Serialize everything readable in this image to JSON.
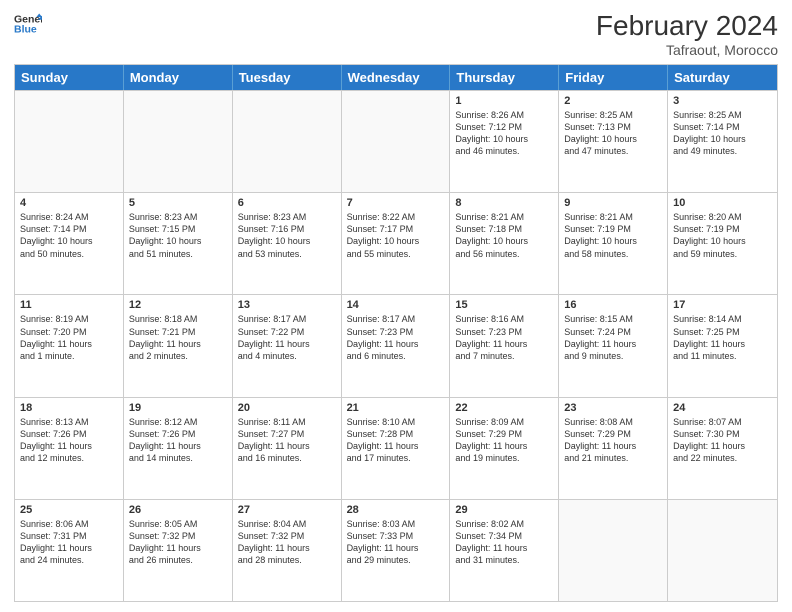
{
  "header": {
    "logo_line1": "General",
    "logo_line2": "Blue",
    "month_year": "February 2024",
    "location": "Tafraout, Morocco"
  },
  "weekdays": [
    "Sunday",
    "Monday",
    "Tuesday",
    "Wednesday",
    "Thursday",
    "Friday",
    "Saturday"
  ],
  "rows": [
    [
      {
        "day": "",
        "info": ""
      },
      {
        "day": "",
        "info": ""
      },
      {
        "day": "",
        "info": ""
      },
      {
        "day": "",
        "info": ""
      },
      {
        "day": "1",
        "info": "Sunrise: 8:26 AM\nSunset: 7:12 PM\nDaylight: 10 hours\nand 46 minutes."
      },
      {
        "day": "2",
        "info": "Sunrise: 8:25 AM\nSunset: 7:13 PM\nDaylight: 10 hours\nand 47 minutes."
      },
      {
        "day": "3",
        "info": "Sunrise: 8:25 AM\nSunset: 7:14 PM\nDaylight: 10 hours\nand 49 minutes."
      }
    ],
    [
      {
        "day": "4",
        "info": "Sunrise: 8:24 AM\nSunset: 7:14 PM\nDaylight: 10 hours\nand 50 minutes."
      },
      {
        "day": "5",
        "info": "Sunrise: 8:23 AM\nSunset: 7:15 PM\nDaylight: 10 hours\nand 51 minutes."
      },
      {
        "day": "6",
        "info": "Sunrise: 8:23 AM\nSunset: 7:16 PM\nDaylight: 10 hours\nand 53 minutes."
      },
      {
        "day": "7",
        "info": "Sunrise: 8:22 AM\nSunset: 7:17 PM\nDaylight: 10 hours\nand 55 minutes."
      },
      {
        "day": "8",
        "info": "Sunrise: 8:21 AM\nSunset: 7:18 PM\nDaylight: 10 hours\nand 56 minutes."
      },
      {
        "day": "9",
        "info": "Sunrise: 8:21 AM\nSunset: 7:19 PM\nDaylight: 10 hours\nand 58 minutes."
      },
      {
        "day": "10",
        "info": "Sunrise: 8:20 AM\nSunset: 7:19 PM\nDaylight: 10 hours\nand 59 minutes."
      }
    ],
    [
      {
        "day": "11",
        "info": "Sunrise: 8:19 AM\nSunset: 7:20 PM\nDaylight: 11 hours\nand 1 minute."
      },
      {
        "day": "12",
        "info": "Sunrise: 8:18 AM\nSunset: 7:21 PM\nDaylight: 11 hours\nand 2 minutes."
      },
      {
        "day": "13",
        "info": "Sunrise: 8:17 AM\nSunset: 7:22 PM\nDaylight: 11 hours\nand 4 minutes."
      },
      {
        "day": "14",
        "info": "Sunrise: 8:17 AM\nSunset: 7:23 PM\nDaylight: 11 hours\nand 6 minutes."
      },
      {
        "day": "15",
        "info": "Sunrise: 8:16 AM\nSunset: 7:23 PM\nDaylight: 11 hours\nand 7 minutes."
      },
      {
        "day": "16",
        "info": "Sunrise: 8:15 AM\nSunset: 7:24 PM\nDaylight: 11 hours\nand 9 minutes."
      },
      {
        "day": "17",
        "info": "Sunrise: 8:14 AM\nSunset: 7:25 PM\nDaylight: 11 hours\nand 11 minutes."
      }
    ],
    [
      {
        "day": "18",
        "info": "Sunrise: 8:13 AM\nSunset: 7:26 PM\nDaylight: 11 hours\nand 12 minutes."
      },
      {
        "day": "19",
        "info": "Sunrise: 8:12 AM\nSunset: 7:26 PM\nDaylight: 11 hours\nand 14 minutes."
      },
      {
        "day": "20",
        "info": "Sunrise: 8:11 AM\nSunset: 7:27 PM\nDaylight: 11 hours\nand 16 minutes."
      },
      {
        "day": "21",
        "info": "Sunrise: 8:10 AM\nSunset: 7:28 PM\nDaylight: 11 hours\nand 17 minutes."
      },
      {
        "day": "22",
        "info": "Sunrise: 8:09 AM\nSunset: 7:29 PM\nDaylight: 11 hours\nand 19 minutes."
      },
      {
        "day": "23",
        "info": "Sunrise: 8:08 AM\nSunset: 7:29 PM\nDaylight: 11 hours\nand 21 minutes."
      },
      {
        "day": "24",
        "info": "Sunrise: 8:07 AM\nSunset: 7:30 PM\nDaylight: 11 hours\nand 22 minutes."
      }
    ],
    [
      {
        "day": "25",
        "info": "Sunrise: 8:06 AM\nSunset: 7:31 PM\nDaylight: 11 hours\nand 24 minutes."
      },
      {
        "day": "26",
        "info": "Sunrise: 8:05 AM\nSunset: 7:32 PM\nDaylight: 11 hours\nand 26 minutes."
      },
      {
        "day": "27",
        "info": "Sunrise: 8:04 AM\nSunset: 7:32 PM\nDaylight: 11 hours\nand 28 minutes."
      },
      {
        "day": "28",
        "info": "Sunrise: 8:03 AM\nSunset: 7:33 PM\nDaylight: 11 hours\nand 29 minutes."
      },
      {
        "day": "29",
        "info": "Sunrise: 8:02 AM\nSunset: 7:34 PM\nDaylight: 11 hours\nand 31 minutes."
      },
      {
        "day": "",
        "info": ""
      },
      {
        "day": "",
        "info": ""
      }
    ]
  ]
}
